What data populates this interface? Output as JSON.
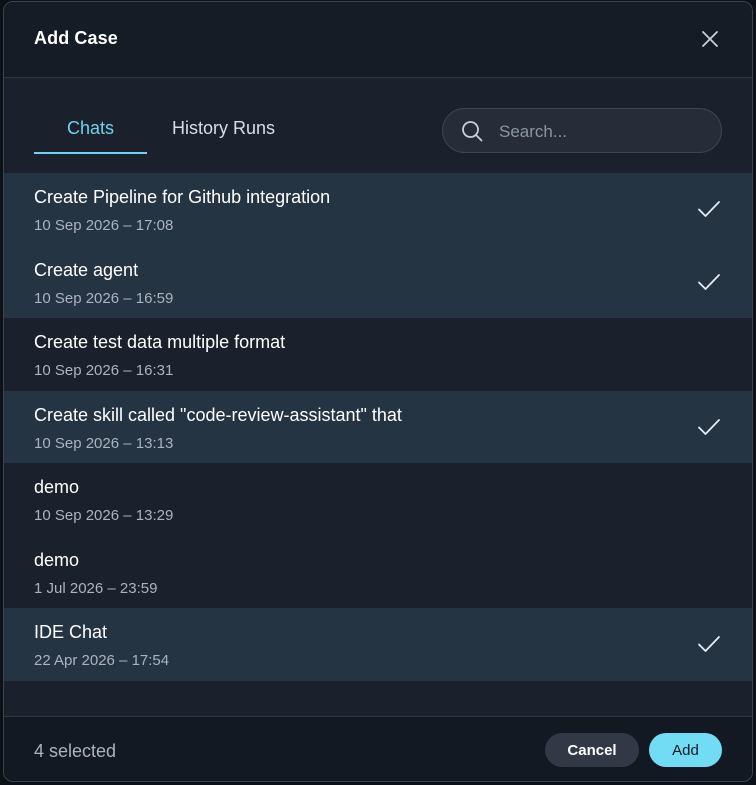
{
  "dialog": {
    "title": "Add Case",
    "close_icon": "close-icon"
  },
  "tabs": [
    {
      "label": "Chats",
      "active": true
    },
    {
      "label": "History Runs",
      "active": false
    }
  ],
  "search": {
    "placeholder": "Search...",
    "value": "",
    "icon": "search-icon"
  },
  "items": [
    {
      "title": "Create Pipeline for Github integration",
      "date": "10 Sep 2026 – 17:08",
      "selected": true
    },
    {
      "title": "Create agent",
      "date": "10 Sep 2026 – 16:59",
      "selected": true
    },
    {
      "title": "Create test data multiple format",
      "date": "10 Sep 2026 – 16:31",
      "selected": false
    },
    {
      "title": "Create skill called \"code-review-assistant\" that",
      "date": "10 Sep 2026 – 13:13",
      "selected": true
    },
    {
      "title": "demo",
      "date": "10 Sep 2026 – 13:29",
      "selected": false
    },
    {
      "title": "demo",
      "date": "1 Jul 2026 – 23:59",
      "selected": false
    },
    {
      "title": "IDE Chat",
      "date": "22 Apr 2026 – 17:54",
      "selected": true
    }
  ],
  "footer": {
    "selected_text": "4 selected",
    "cancel_label": "Cancel",
    "add_label": "Add"
  },
  "colors": {
    "accent": "#6fd3ee",
    "selected_row": "#253442",
    "add_button": "#72dcf5"
  }
}
